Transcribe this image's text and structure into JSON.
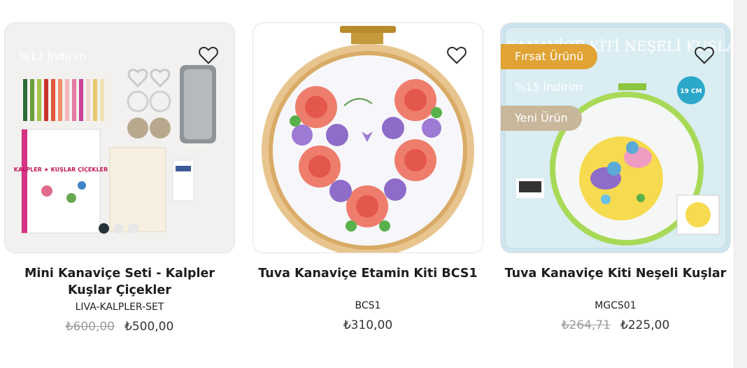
{
  "products": [
    {
      "title": "Mini Kanaviçe Seti - Kalpler Kuşlar Çiçekler",
      "code": "LIVA-KALPLER-SET",
      "old_price": "₺600,00",
      "price": "₺500,00",
      "badges": [
        {
          "text": "%17 İndirim",
          "color": "#263238"
        }
      ],
      "book_text": "KALPLER ★ KUŞLAR ÇİÇEKLER",
      "favorite_icon": "heart-outline-icon",
      "carousel_dots": 3,
      "active_dot": 0
    },
    {
      "title": "Tuva Kanaviçe Etamin Kiti BCS1",
      "code": "BCS1",
      "old_price": "",
      "price": "₺310,00",
      "badges": [],
      "favorite_icon": "heart-outline-icon"
    },
    {
      "title": "Tuva Kanaviçe Kiti Neşeli Kuşlar",
      "code": "MGCS01",
      "old_price": "₺264,71",
      "price": "₺225,00",
      "badges": [
        {
          "text": "Fırsat Ürünü",
          "color": "#e0a334"
        },
        {
          "text": "%15 İndirim",
          "color": "#263238"
        },
        {
          "text": "Yeni Ürün",
          "color": "#c9b79b"
        }
      ],
      "package_text": "KANAVİÇE KİTİ NEŞELİ KUŞLAR",
      "size_badge": "19 CM",
      "favorite_icon": "heart-outline-icon"
    }
  ]
}
